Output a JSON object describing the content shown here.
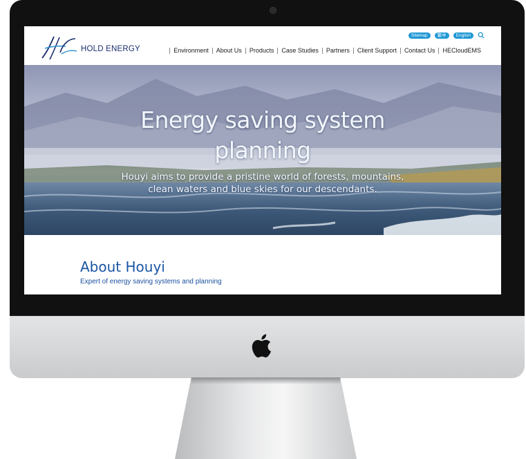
{
  "header": {
    "brand": "HOLD ENERGY",
    "utility_links": [
      "Sitemap",
      "繁中",
      "English"
    ],
    "search_icon": "search-icon"
  },
  "nav": {
    "items": [
      "Environment",
      "About Us",
      "Products",
      "Case Studies",
      "Partners",
      "Client Support",
      "Contact Us",
      "HECloudEMS"
    ]
  },
  "hero": {
    "title_line1": "Energy saving system",
    "title_line2": "planning",
    "subtitle_line1": "Houyi aims to provide a pristine world of forests, mountains,",
    "subtitle_line2": "clean waters and blue skies for our descendants."
  },
  "about": {
    "title": "About Houyi",
    "subtitle": "Expert of energy saving systems and planning"
  },
  "colors": {
    "accent": "#1f97d5",
    "brand": "#1a2d6e",
    "heading": "#1a55a4"
  },
  "device": {
    "logo_icon": "apple-logo-icon"
  }
}
